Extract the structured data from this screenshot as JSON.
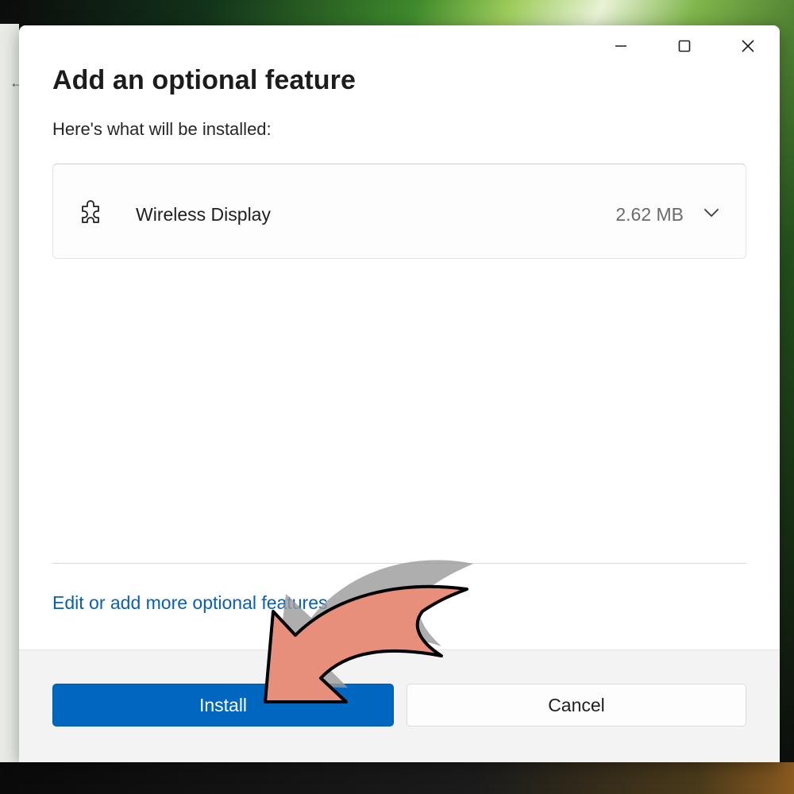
{
  "dialog": {
    "title": "Add an optional feature",
    "subtitle": "Here's what will be installed:",
    "feature": {
      "name": "Wireless Display",
      "size": "2.62 MB",
      "icon": "puzzle-piece-icon",
      "expand_icon": "chevron-down-icon"
    },
    "more_link": "Edit or add more optional features",
    "buttons": {
      "install": "Install",
      "cancel": "Cancel"
    }
  },
  "window_controls": {
    "minimize_icon": "minimize-icon",
    "maximize_icon": "maximize-icon",
    "close_icon": "close-icon"
  },
  "colors": {
    "accent": "#0067c0",
    "link": "#0a5fb4",
    "annotation_arrow": "#e88f7c"
  }
}
